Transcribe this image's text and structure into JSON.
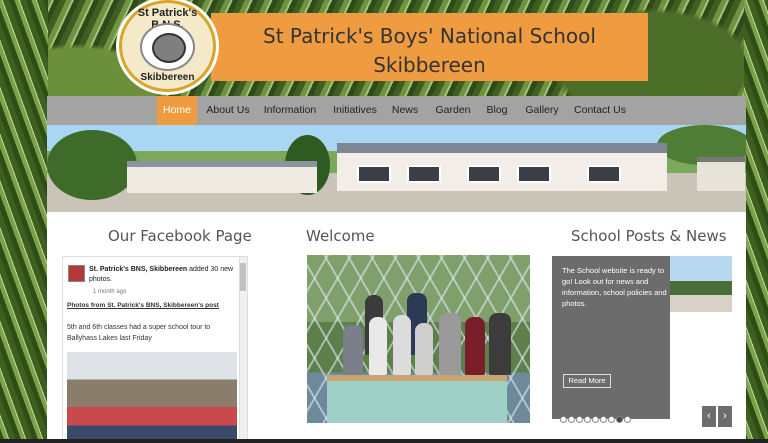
{
  "logo": {
    "text_top": "St Patrick's B.N.S.",
    "text_bottom": "Skibbereen"
  },
  "header": {
    "title_line1": "St Patrick's Boys' National School",
    "title_line2": "Skibbereen"
  },
  "nav": {
    "items": [
      {
        "label": "Home",
        "active": true
      },
      {
        "label": "About Us",
        "active": false
      },
      {
        "label": "Information",
        "active": false
      },
      {
        "label": "Initiatives",
        "active": false
      },
      {
        "label": "News",
        "active": false
      },
      {
        "label": "Garden",
        "active": false
      },
      {
        "label": "Blog",
        "active": false
      },
      {
        "label": "Gallery",
        "active": false
      },
      {
        "label": "Contact Us",
        "active": false
      }
    ]
  },
  "sections": {
    "facebook_title": "Our Facebook Page",
    "welcome_title": "Welcome",
    "posts_title": "School Posts & News"
  },
  "facebook": {
    "page_name": "St. Patrick's BNS, Skibbereen",
    "action": "added 30 new photos.",
    "time": "1 month ago",
    "link": "Photos from St. Patrick's BNS, Skibbereen's post",
    "post_text": "5th and 6th classes had a super school tour to Ballyhass Lakes last Friday"
  },
  "posts": {
    "text": "The School website is ready to go! Look out for news and information, school policies and photos.",
    "read_more": "Read More",
    "slide_count": 9,
    "active_slide": 8
  },
  "colors": {
    "accent_orange": "#ef9b3f",
    "nav_gray": "#a3a3a3",
    "panel_white": "#ffffff",
    "posts_gray": "#6c6c6c"
  },
  "icons": {
    "prev": "‹",
    "next": "›"
  }
}
